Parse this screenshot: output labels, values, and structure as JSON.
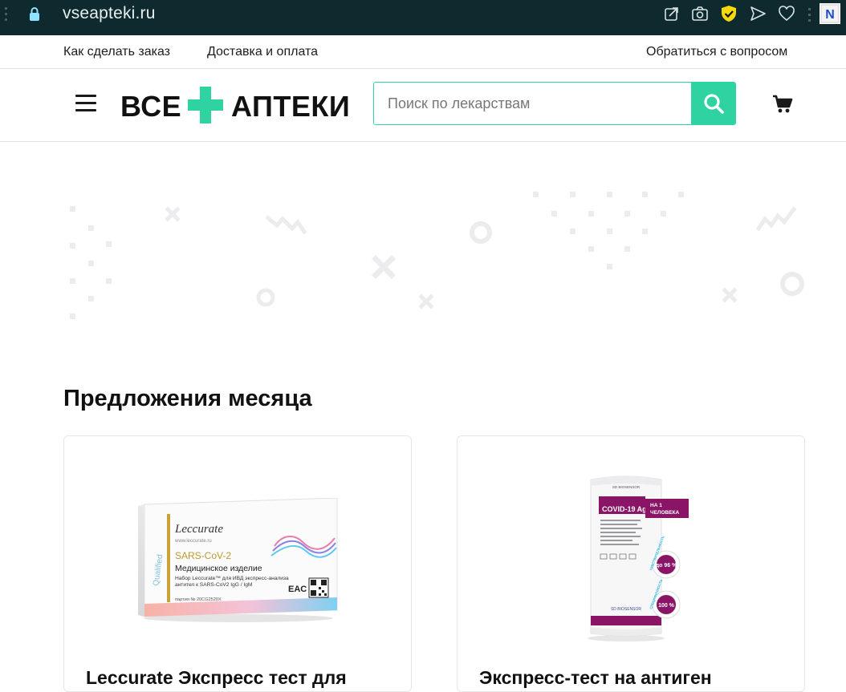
{
  "browser": {
    "url": "vseapteki.ru",
    "extension_label": "N",
    "toolbar_icons": [
      "share-icon",
      "camera-icon",
      "shield-check-icon",
      "send-icon",
      "heart-icon"
    ]
  },
  "top_links": {
    "how_to_order": "Как сделать заказ",
    "delivery": "Доставка и оплата",
    "ask_question": "Обратиться с вопросом"
  },
  "header": {
    "logo_left": "ВСЕ",
    "logo_right": "АПТЕКИ",
    "search_placeholder": "Поиск по лекарствам"
  },
  "colors": {
    "accent": "#2fd3a2",
    "addrbar": "#0e2a2e"
  },
  "section": {
    "title": "Предложения месяца",
    "products": [
      {
        "title": "Leccurate Экспресс тест для",
        "box": {
          "brand": "Leccurate",
          "site": "www.leccurate.ru",
          "side": "Qualified",
          "name": "SARS-CoV-2",
          "type": "Медицинское изделие",
          "desc1": "Набор Leccurate™ для ИВД экспресс-анализа",
          "desc2": "антител к SARS-CoV2 IgG / IgM",
          "batch": "партия № 20CG2520X",
          "mark": "EAC"
        }
      },
      {
        "title": "Экспресс-тест на антиген",
        "box": {
          "maker": "SD BIOSENSOR",
          "name": "COVID-19 Ag",
          "tag1": "НА 1",
          "tag2": "ЧЕЛОВЕКА",
          "sens_label": "ЧУВСТВИТЕЛЬНОСТЬ",
          "sens_value": "до 96 %",
          "spec_label": "СПЕЦИФИЧНОСТЬ",
          "spec_value": "100 %"
        }
      }
    ]
  }
}
